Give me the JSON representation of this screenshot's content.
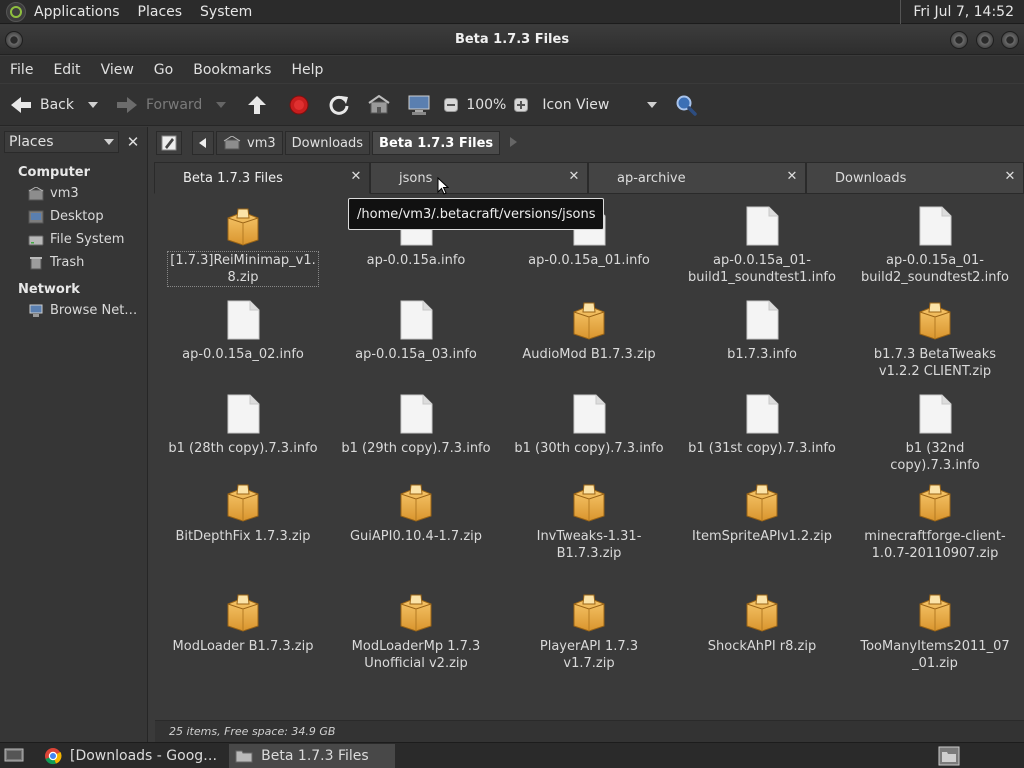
{
  "top_panel": {
    "menus": [
      "Applications",
      "Places",
      "System"
    ],
    "clock": "Fri Jul  7, 14:52"
  },
  "window": {
    "title": "Beta 1.7.3 Files"
  },
  "menubar": [
    "File",
    "Edit",
    "View",
    "Go",
    "Bookmarks",
    "Help"
  ],
  "toolbar": {
    "back": "Back",
    "forward": "Forward",
    "zoom": "100%",
    "view_mode": "Icon View"
  },
  "sidebar": {
    "selector": "Places",
    "sections": [
      {
        "title": "Computer",
        "items": [
          "vm3",
          "Desktop",
          "File System",
          "Trash"
        ]
      },
      {
        "title": "Network",
        "items": [
          "Browse Net…"
        ]
      }
    ]
  },
  "breadcrumbs": [
    "vm3",
    "Downloads",
    "Beta 1.7.3 Files"
  ],
  "tabs": [
    "Beta 1.7.3 Files",
    "jsons",
    "ap-archive",
    "Downloads"
  ],
  "tooltip": "/home/vm3/.betacraft/versions/jsons",
  "files": [
    {
      "name": "[1.7.3]ReiMinimap_v1.8.zip",
      "type": "zip"
    },
    {
      "name": "ap-0.0.15a.info",
      "type": "doc"
    },
    {
      "name": "ap-0.0.15a_01.info",
      "type": "doc"
    },
    {
      "name": "ap-0.0.15a_01-build1_soundtest1.info",
      "type": "doc"
    },
    {
      "name": "ap-0.0.15a_01-build2_soundtest2.info",
      "type": "doc"
    },
    {
      "name": "ap-0.0.15a_02.info",
      "type": "doc"
    },
    {
      "name": "ap-0.0.15a_03.info",
      "type": "doc"
    },
    {
      "name": "AudioMod B1.7.3.zip",
      "type": "zip"
    },
    {
      "name": "b1.7.3.info",
      "type": "doc"
    },
    {
      "name": "b1.7.3 BetaTweaks v1.2.2 CLIENT.zip",
      "type": "zip"
    },
    {
      "name": "b1 (28th copy).7.3.info",
      "type": "doc"
    },
    {
      "name": "b1 (29th copy).7.3.info",
      "type": "doc"
    },
    {
      "name": "b1 (30th copy).7.3.info",
      "type": "doc"
    },
    {
      "name": "b1 (31st copy).7.3.info",
      "type": "doc"
    },
    {
      "name": "b1 (32nd copy).7.3.info",
      "type": "doc"
    },
    {
      "name": "BitDepthFix 1.7.3.zip",
      "type": "zip"
    },
    {
      "name": "GuiAPI0.10.4-1.7.zip",
      "type": "zip"
    },
    {
      "name": "InvTweaks-1.31-B1.7.3.zip",
      "type": "zip"
    },
    {
      "name": "ItemSpriteAPIv1.2.zip",
      "type": "zip"
    },
    {
      "name": "minecraftforge-client-1.0.7-20110907.zip",
      "type": "zip"
    },
    {
      "name": "ModLoader B1.7.3.zip",
      "type": "zip"
    },
    {
      "name": "ModLoaderMp 1.7.3 Unofficial v2.zip",
      "type": "zip"
    },
    {
      "name": "PlayerAPI 1.7.3 v1.7.zip",
      "type": "zip"
    },
    {
      "name": "ShockAhPI r8.zip",
      "type": "zip"
    },
    {
      "name": "TooManyItems2011_07_01.zip",
      "type": "zip"
    }
  ],
  "status": "25 items, Free space: 34.9 GB",
  "taskbar": [
    "[Downloads - Goog…",
    "Beta 1.7.3 Files"
  ]
}
